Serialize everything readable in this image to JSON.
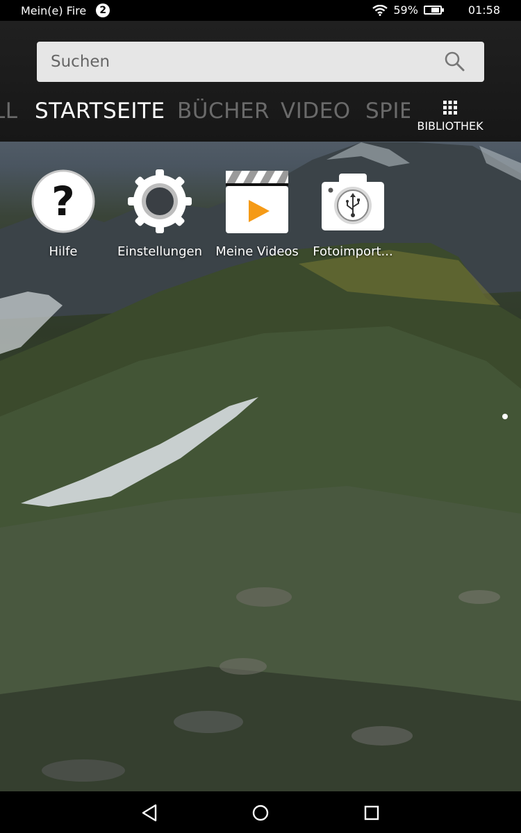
{
  "status_bar": {
    "carrier": "Mein(e) Fire",
    "notification_count": "2",
    "battery_percent": "59%",
    "battery_level": 0.59,
    "time": "01:58"
  },
  "search": {
    "placeholder": "Suchen"
  },
  "tabs": [
    {
      "label": "LL"
    },
    {
      "label": "STARTSEITE"
    },
    {
      "label": "BÜCHER"
    },
    {
      "label": "VIDEO"
    },
    {
      "label": "SPIE"
    }
  ],
  "library": {
    "label": "BIBLIOTHEK"
  },
  "apps": [
    {
      "label": "Hilfe"
    },
    {
      "label": "Einstellungen"
    },
    {
      "label": "Meine Videos"
    },
    {
      "label": "Fotoimport..."
    }
  ],
  "colors": {
    "accent_orange": "#f59a16",
    "tab_active": "#ffffff",
    "tab_inactive": "#6a6a6a"
  }
}
